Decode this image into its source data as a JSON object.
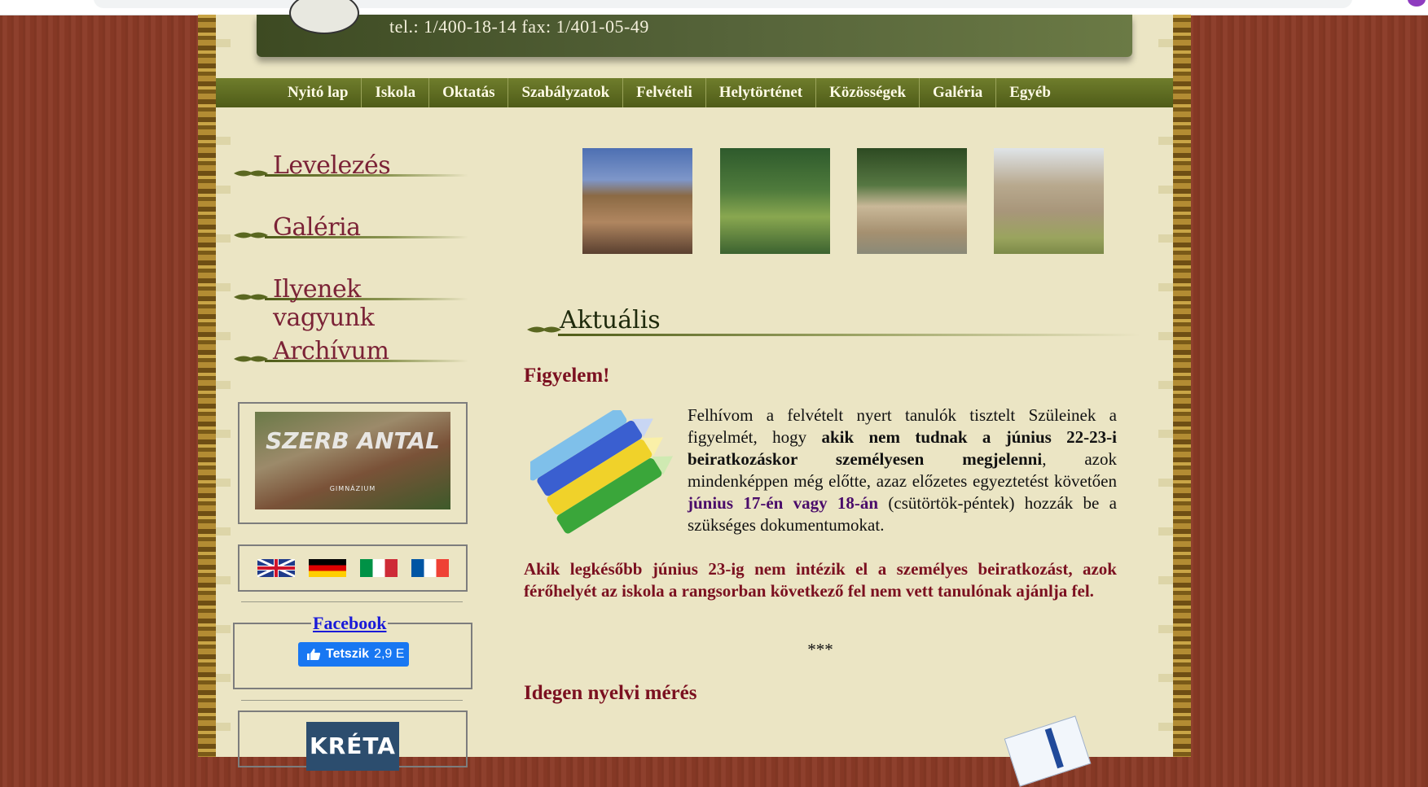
{
  "header": {
    "contact": "tel.: 1/400-18-14  fax: 1/401-05-49"
  },
  "nav": {
    "items": [
      "Nyitó lap",
      "Iskola",
      "Oktatás",
      "Szabályzatok",
      "Felvételi",
      "Helytörténet",
      "Közösségek",
      "Galéria",
      "Egyéb"
    ]
  },
  "sidebar": {
    "headings": [
      "Levelezés",
      "Galéria",
      "Ilyenek vagyunk",
      "Archívum"
    ],
    "school_logo_text": "SZERB ANTAL",
    "school_logo_sub": "GIMNÁZIUM",
    "flags": [
      "uk-flag",
      "german-flag",
      "italian-flag",
      "french-flag"
    ],
    "facebook": {
      "title": "Facebook",
      "like_label": "Tetszik",
      "like_count": "2,9 E"
    },
    "kreta": "KRÉTA"
  },
  "main": {
    "section_title": "Aktuális",
    "notice_title": "Figyelem!",
    "paragraph": {
      "p1": "Felhívom a felvételt nyert tanulók tisztelt Szüleinek a figyelmét, hogy ",
      "p1_bold": "akik nem tudnak a június 22-23-i beiratkozáskor személyesen megjelenni",
      "p2": ", azok mindenképpen még előtte, azaz előzetes egyeztetést követően ",
      "p2_purple": "június 17-én vagy 18-án",
      "p3": " (csütörtök-péntek) hozzák be a szükséges dokumentumokat."
    },
    "warning": "Akik legkésőbb június 23-ig nem intézik el a személyes beiratkozást, azok férőhelyét az iskola a rangsorban következő fel nem vett tanulónak ajánlja fel.",
    "separator": "***",
    "next_title": "Idegen nyelvi mérés"
  },
  "colors": {
    "page_bg": "#ebe5c4",
    "nav_bg": "#5a6720",
    "heading_red": "#7b1020",
    "sidebar_heading": "#7b2236",
    "wood": "#8a3a26"
  }
}
